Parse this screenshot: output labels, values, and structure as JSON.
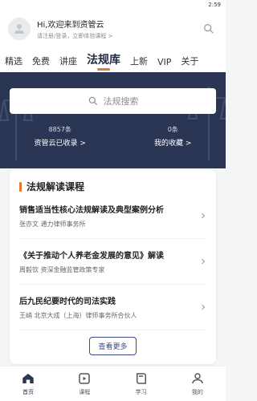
{
  "status": {
    "time": "2:59"
  },
  "header": {
    "greeting": "Hi,欢迎来到资管云",
    "subtitle": "请注册/登录，立即体验课程 >"
  },
  "tabs": [
    {
      "label": "精选",
      "active": false
    },
    {
      "label": "免费",
      "active": false
    },
    {
      "label": "讲座",
      "active": false
    },
    {
      "label": "法规库",
      "active": true
    },
    {
      "label": "上新",
      "active": false
    },
    {
      "label": "VIP",
      "active": false
    },
    {
      "label": "关于",
      "active": false
    }
  ],
  "search": {
    "placeholder": "法规搜索"
  },
  "stats": {
    "left": {
      "value": "8857条",
      "label": "资管云已收录 >"
    },
    "right": {
      "value": "0条",
      "label": "我的收藏 >"
    }
  },
  "section": {
    "title": "法规解读课程",
    "items": [
      {
        "title": "销售适当性核心法规解读及典型案例分析",
        "meta": "张亦文  通力律师事务所"
      },
      {
        "title": "《关于推动个人养老金发展的意见》解读",
        "meta": "周毅钦  资深金融监管政策专家"
      },
      {
        "title": "后九民纪要时代的司法实践",
        "meta": "王峭  北京大成（上海）律师事务所合伙人"
      }
    ],
    "more_label": "查看更多"
  },
  "bottom_nav": [
    {
      "label": "首页",
      "icon": "home-icon",
      "active": true
    },
    {
      "label": "课程",
      "icon": "course-icon",
      "active": false
    },
    {
      "label": "学习",
      "icon": "book-icon",
      "active": false
    },
    {
      "label": "我的",
      "icon": "user-icon",
      "active": false
    }
  ],
  "colors": {
    "accent": "#e37b2d",
    "hero": "#2b3654"
  }
}
